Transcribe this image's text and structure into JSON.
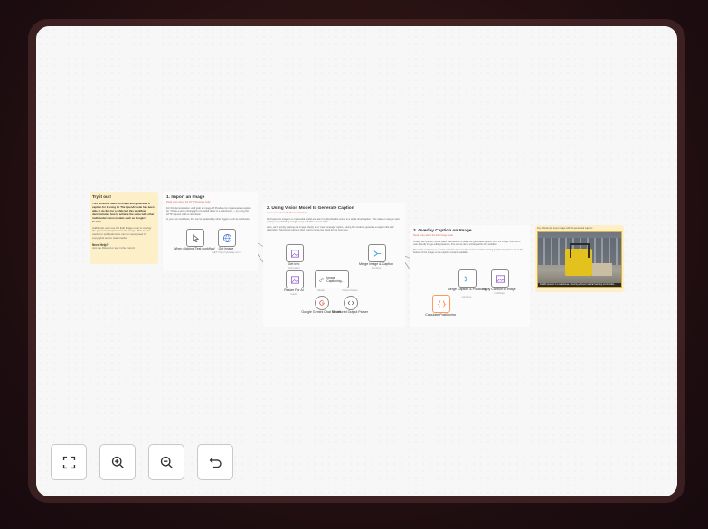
{
  "intro_note": {
    "title": "Try it out!",
    "bold_text": "This workflow takes an image and generates a caption for it using AI. The OpenAI node has been able to do this for a while but this workflow demonstrates how to achieve the same with other multimodal vision models such as Google's Gemini.",
    "text": "Additional, we'll use the Edit Image node to overlay the generated caption onto the image. This can be useful for publications or can be repurposed for copyrights and/or watermarks.",
    "help_title": "Need Help?",
    "help_text": "Join the Discord or ask in the Forum!"
  },
  "section1": {
    "title": "1. Import an Image",
    "subtitle": "Read more about the HTTP Request node",
    "text1": "For this demonstration, we'll grab an image off Pixabay.com to generate a caption for. This is a stock photograph of a forklift driver in a warehouse — try using the HTTP request node to download.",
    "text2": "In your own workflows, this can be replaced by other triggers such as webhooks."
  },
  "section2": {
    "title": "2. Using Vision Model to Generate Caption",
    "subtitle": "Learn more about the Basic LLM Chain",
    "text1": "We'll pass the image to a multimodal model and ask it to describe the scene in a single short caption. This makes it easy to start editing and publishing straight away with little manual effort.",
    "text2": "Here, we're simply passing our image directly as a \"user message\" option, asking the model to generate a caption title and description. Structured output is then used to parse the result for the next step."
  },
  "section3": {
    "title": "3. Overlay Caption on Image",
    "subtitle": "Read more about the Edit Image node",
    "text1": "Finally, we'll perform some basic calculations to place the generated caption onto the image. With n8n's user-friendly image editing features, this can be done entirely within the workflow.",
    "text2": "The Code node here is used to calculate the text dimensions and the starting position for placement at the bottom of the image so the caption remains readable."
  },
  "result_note": {
    "label": "Fig 1. Example input image with AI generated caption",
    "caption": "Forklift operator in a warehouse: ensuring efficient material handling and logistics."
  },
  "nodes": {
    "trigger": {
      "label": "When clicking 'Test workflow'",
      "sub": ""
    },
    "get_image": {
      "label": "Get Image",
      "sub": "GET: https://pixabay.com"
    },
    "get_info": {
      "label": "Get Info",
      "sub": "information"
    },
    "resize": {
      "label": "Resize For AI",
      "sub": "resize"
    },
    "captioning": {
      "label": "Image Captioning...",
      "sub": ""
    },
    "gemini": {
      "label": "Google Gemini Chat Model",
      "sub": ""
    },
    "parser": {
      "label": "Structured Output Parser",
      "sub": ""
    },
    "merge1": {
      "label": "Merge Image & Caption",
      "sub": "combine"
    },
    "merge2": {
      "label": "Merge Caption & Positions",
      "sub": "combine"
    },
    "position": {
      "label": "Calculate Positioning",
      "sub": ""
    },
    "apply": {
      "label": "Apply Caption to Image",
      "sub": "multiStep"
    }
  },
  "port_labels": {
    "model": "Model",
    "output_parser": "Output Parser"
  },
  "toolbar": {
    "fit": "fit-to-view",
    "zoom_in": "zoom-in",
    "zoom_out": "zoom-out",
    "reset": "reset-zoom"
  },
  "colors": {
    "yellow_note": "#fdf0c8",
    "note_bg": "#fbfbfb",
    "accent": "#e06b5a",
    "orange_node": "#ff9a5c"
  }
}
